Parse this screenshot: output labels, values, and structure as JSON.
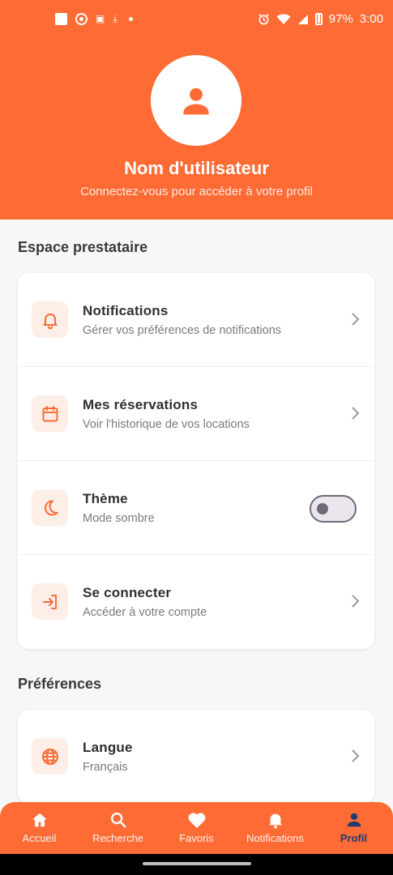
{
  "status_bar": {
    "battery": "97%",
    "time": "3:00"
  },
  "header": {
    "user_name": "Nom d'utilisateur",
    "subtitle": "Connectez-vous pour accéder à votre profil"
  },
  "sections": [
    {
      "title": "Espace prestataire",
      "items": [
        {
          "icon": "bell-icon",
          "title": "Notifications",
          "subtitle": "Gérer vos préférences de notifications",
          "control": "chevron"
        },
        {
          "icon": "calendar-icon",
          "title": "Mes réservations",
          "subtitle": "Voir l'historique de vos locations",
          "control": "chevron"
        },
        {
          "icon": "moon-icon",
          "title": "Thème",
          "subtitle": "Mode sombre",
          "control": "toggle",
          "toggle_on": false
        },
        {
          "icon": "login-icon",
          "title": "Se connecter",
          "subtitle": "Accéder à votre compte",
          "control": "chevron"
        }
      ]
    },
    {
      "title": "Préférences",
      "items": [
        {
          "icon": "globe-icon",
          "title": "Langue",
          "subtitle": "Français",
          "control": "chevron"
        }
      ]
    }
  ],
  "bottom_nav": {
    "items": [
      {
        "icon": "home-icon",
        "label": "Accueil"
      },
      {
        "icon": "search-icon",
        "label": "Recherche"
      },
      {
        "icon": "heart-icon",
        "label": "Favoris"
      },
      {
        "icon": "bell-icon",
        "label": "Notifications"
      },
      {
        "icon": "person-icon",
        "label": "Profil",
        "active": true
      }
    ]
  },
  "colors": {
    "accent": "#ff6b35",
    "active_nav": "#1f3a6e",
    "icon_bg": "#fdeee7"
  }
}
